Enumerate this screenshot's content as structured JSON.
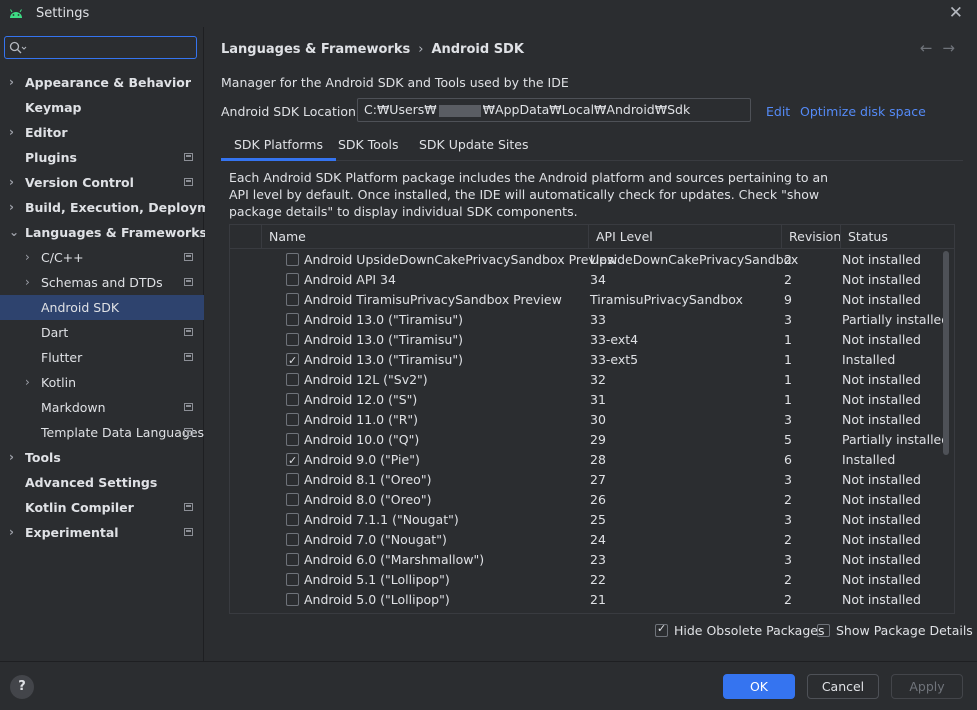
{
  "window": {
    "title": "Settings"
  },
  "sidebar": {
    "search_placeholder": "",
    "items": [
      {
        "label": "Appearance & Behavior",
        "bold": true,
        "chevron": "›",
        "indent": 0,
        "proj": false,
        "selected": false
      },
      {
        "label": "Keymap",
        "bold": true,
        "chevron": "",
        "indent": 0,
        "proj": false,
        "selected": false
      },
      {
        "label": "Editor",
        "bold": true,
        "chevron": "›",
        "indent": 0,
        "proj": false,
        "selected": false
      },
      {
        "label": "Plugins",
        "bold": true,
        "chevron": "",
        "indent": 0,
        "proj": true,
        "selected": false
      },
      {
        "label": "Version Control",
        "bold": true,
        "chevron": "›",
        "indent": 0,
        "proj": true,
        "selected": false
      },
      {
        "label": "Build, Execution, Deployment",
        "bold": true,
        "chevron": "›",
        "indent": 0,
        "proj": false,
        "selected": false
      },
      {
        "label": "Languages & Frameworks",
        "bold": true,
        "chevron": "⌄",
        "indent": 0,
        "proj": false,
        "selected": false
      },
      {
        "label": "C/C++",
        "bold": false,
        "chevron": "›",
        "indent": 1,
        "proj": true,
        "selected": false
      },
      {
        "label": "Schemas and DTDs",
        "bold": false,
        "chevron": "›",
        "indent": 1,
        "proj": true,
        "selected": false
      },
      {
        "label": "Android SDK",
        "bold": false,
        "chevron": "",
        "indent": 1,
        "proj": false,
        "selected": true
      },
      {
        "label": "Dart",
        "bold": false,
        "chevron": "",
        "indent": 1,
        "proj": true,
        "selected": false
      },
      {
        "label": "Flutter",
        "bold": false,
        "chevron": "",
        "indent": 1,
        "proj": true,
        "selected": false
      },
      {
        "label": "Kotlin",
        "bold": false,
        "chevron": "›",
        "indent": 1,
        "proj": false,
        "selected": false
      },
      {
        "label": "Markdown",
        "bold": false,
        "chevron": "",
        "indent": 1,
        "proj": true,
        "selected": false
      },
      {
        "label": "Template Data Languages",
        "bold": false,
        "chevron": "",
        "indent": 1,
        "proj": true,
        "selected": false
      },
      {
        "label": "Tools",
        "bold": true,
        "chevron": "›",
        "indent": 0,
        "proj": false,
        "selected": false
      },
      {
        "label": "Advanced Settings",
        "bold": true,
        "chevron": "",
        "indent": 0,
        "proj": false,
        "selected": false
      },
      {
        "label": "Kotlin Compiler",
        "bold": true,
        "chevron": "",
        "indent": 0,
        "proj": true,
        "selected": false
      },
      {
        "label": "Experimental",
        "bold": true,
        "chevron": "›",
        "indent": 0,
        "proj": true,
        "selected": false
      }
    ]
  },
  "header": {
    "crumb_parent": "Languages & Frameworks",
    "crumb_separator": "›",
    "crumb_current": "Android SDK",
    "back_arrow": "←",
    "forward_arrow": "→"
  },
  "main": {
    "description": "Manager for the Android SDK and Tools used by the IDE",
    "location_label": "Android SDK Location:",
    "location_prefix": "C:₩Users₩",
    "location_suffix": "₩AppData₩Local₩Android₩Sdk",
    "edit_link": "Edit",
    "optimize_link": "Optimize disk space",
    "tabs": [
      {
        "label": "SDK Platforms",
        "active": true
      },
      {
        "label": "SDK Tools",
        "active": false
      },
      {
        "label": "SDK Update Sites",
        "active": false
      }
    ],
    "panel_text": "Each Android SDK Platform package includes the Android platform and sources pertaining to an API level by default. Once installed, the IDE will automatically check for updates. Check \"show package details\" to display individual SDK components.",
    "columns": {
      "name": "Name",
      "api": "API Level",
      "revision": "Revision",
      "status": "Status"
    },
    "rows": [
      {
        "checked": false,
        "name": "Android UpsideDownCakePrivacySandbox Preview",
        "api": "UpsideDownCakePrivacySandbox",
        "revision": "2",
        "status": "Not installed"
      },
      {
        "checked": false,
        "name": "Android API 34",
        "api": "34",
        "revision": "2",
        "status": "Not installed"
      },
      {
        "checked": false,
        "name": "Android TiramisuPrivacySandbox Preview",
        "api": "TiramisuPrivacySandbox",
        "revision": "9",
        "status": "Not installed"
      },
      {
        "checked": false,
        "name": "Android 13.0 (\"Tiramisu\")",
        "api": "33",
        "revision": "3",
        "status": "Partially installed"
      },
      {
        "checked": false,
        "name": "Android 13.0 (\"Tiramisu\")",
        "api": "33-ext4",
        "revision": "1",
        "status": "Not installed"
      },
      {
        "checked": true,
        "name": "Android 13.0 (\"Tiramisu\")",
        "api": "33-ext5",
        "revision": "1",
        "status": "Installed"
      },
      {
        "checked": false,
        "name": "Android 12L (\"Sv2\")",
        "api": "32",
        "revision": "1",
        "status": "Not installed"
      },
      {
        "checked": false,
        "name": "Android 12.0 (\"S\")",
        "api": "31",
        "revision": "1",
        "status": "Not installed"
      },
      {
        "checked": false,
        "name": "Android 11.0 (\"R\")",
        "api": "30",
        "revision": "3",
        "status": "Not installed"
      },
      {
        "checked": false,
        "name": "Android 10.0 (\"Q\")",
        "api": "29",
        "revision": "5",
        "status": "Partially installed"
      },
      {
        "checked": true,
        "name": "Android 9.0 (\"Pie\")",
        "api": "28",
        "revision": "6",
        "status": "Installed"
      },
      {
        "checked": false,
        "name": "Android 8.1 (\"Oreo\")",
        "api": "27",
        "revision": "3",
        "status": "Not installed"
      },
      {
        "checked": false,
        "name": "Android 8.0 (\"Oreo\")",
        "api": "26",
        "revision": "2",
        "status": "Not installed"
      },
      {
        "checked": false,
        "name": "Android 7.1.1 (\"Nougat\")",
        "api": "25",
        "revision": "3",
        "status": "Not installed"
      },
      {
        "checked": false,
        "name": "Android 7.0 (\"Nougat\")",
        "api": "24",
        "revision": "2",
        "status": "Not installed"
      },
      {
        "checked": false,
        "name": "Android 6.0 (\"Marshmallow\")",
        "api": "23",
        "revision": "3",
        "status": "Not installed"
      },
      {
        "checked": false,
        "name": "Android 5.1 (\"Lollipop\")",
        "api": "22",
        "revision": "2",
        "status": "Not installed"
      },
      {
        "checked": false,
        "name": "Android 5.0 (\"Lollipop\")",
        "api": "21",
        "revision": "2",
        "status": "Not installed"
      }
    ],
    "hide_obsolete_label": "Hide Obsolete Packages",
    "hide_obsolete_checked": true,
    "show_details_label": "Show Package Details",
    "show_details_checked": false
  },
  "footer": {
    "help": "?",
    "ok": "OK",
    "cancel": "Cancel",
    "apply": "Apply"
  },
  "colors": {
    "accent": "#3574f0",
    "selection": "#2e436e",
    "link": "#548af7",
    "background": "#2b2d30"
  },
  "icons": {
    "app": "android-icon",
    "search": "search-icon",
    "close": "close-icon"
  }
}
